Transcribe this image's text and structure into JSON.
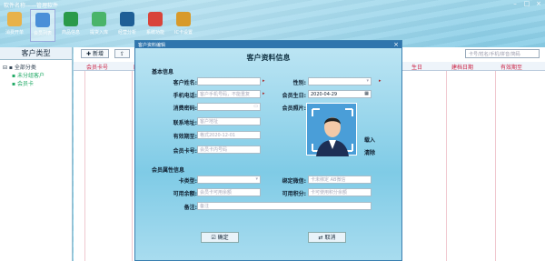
{
  "app": {
    "title": "软件名称——管理软件"
  },
  "toolbar": [
    {
      "label": "消费开单",
      "color": "#e8b24a"
    },
    {
      "label": "会员列表",
      "color": "#4a8fd8"
    },
    {
      "label": "商品信息",
      "color": "#2a9a4a"
    },
    {
      "label": "提货入库",
      "color": "#4ab46a"
    },
    {
      "label": "经营分析",
      "color": "#1f5f96"
    },
    {
      "label": "系统功能",
      "color": "#d8443a"
    },
    {
      "label": "IC卡设置",
      "color": "#d89a2a"
    }
  ],
  "left": {
    "header": "客户类型",
    "tree": {
      "root": "全部分类",
      "children": [
        "未分组客户",
        "会员卡"
      ]
    }
  },
  "main": {
    "buttons": {
      "add": "新增"
    },
    "search_placeholder": "卡号/姓名/手机/拼音/简码",
    "columns": {
      "c1": "会员卡号",
      "c2": "所",
      "c3": "生日",
      "c4": "建档日期",
      "c5": "有效期至"
    }
  },
  "dialog": {
    "titlebar": "客户资料编辑",
    "heading": "客户资料信息",
    "basic_section": "基本信息",
    "fields": {
      "name": {
        "label": "客户姓名:",
        "value": ""
      },
      "gender": {
        "label": "性别:",
        "value": ""
      },
      "phone": {
        "label": "手机电话:",
        "placeholder": "客户手机号码，不能重复"
      },
      "birthday": {
        "label": "会员生日:",
        "value": "2020-04-29"
      },
      "password": {
        "label": "消费密码:",
        "value": ""
      },
      "photo": {
        "label": "会员照片:"
      },
      "address": {
        "label": "联系地址:",
        "placeholder": "客户地址"
      },
      "expire": {
        "label": "有效期至:",
        "placeholder": "格式2020-12-01"
      },
      "card": {
        "label": "会员卡号:",
        "placeholder": "会员卡内号码"
      }
    },
    "photo_actions": {
      "import": "载入",
      "clear": "清除"
    },
    "member_section": "会员属性信息",
    "member_fields": {
      "card_type": {
        "label": "卡类型:",
        "value": ""
      },
      "wechat": {
        "label": "绑定微信:",
        "placeholder": "卡未绑定 AB微信"
      },
      "balance": {
        "label": "可用余额:",
        "placeholder": "会员卡可用余额"
      },
      "points": {
        "label": "可用积分:",
        "placeholder": "卡可使用积分余额"
      },
      "note": {
        "label": "备注:",
        "placeholder": "备注"
      }
    },
    "ok": "确定",
    "cancel": "取消"
  }
}
